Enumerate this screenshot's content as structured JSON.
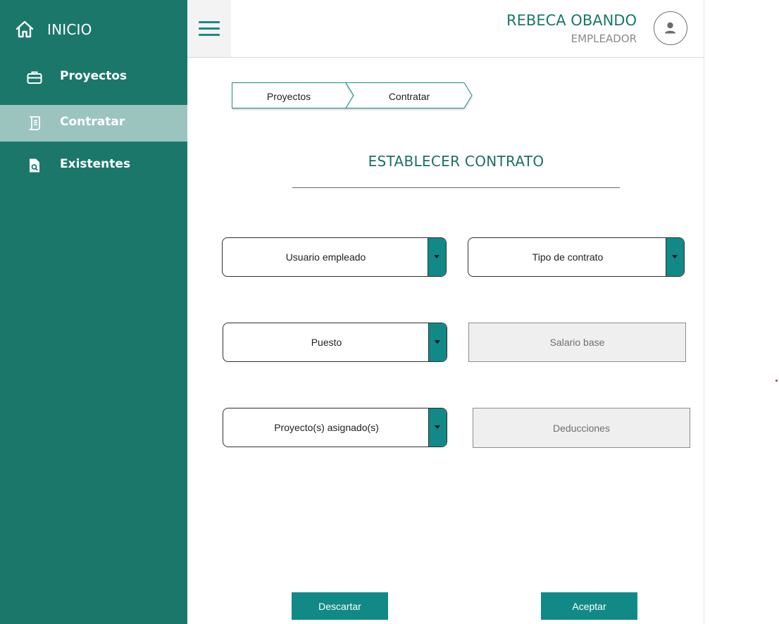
{
  "sidebar": {
    "home": {
      "label": "INICIO",
      "icon": "home-icon"
    },
    "items": [
      {
        "label": "Proyectos",
        "icon": "briefcase-icon",
        "active": false
      },
      {
        "label": "Contratar",
        "icon": "contract-icon",
        "active": true
      },
      {
        "label": "Existentes",
        "icon": "document-search-icon",
        "active": false
      }
    ]
  },
  "header": {
    "menu_icon": "hamburger-menu-icon",
    "user_name": "REBECA OBANDO",
    "user_role": "EMPLEADOR",
    "avatar_icon": "user-avatar-icon"
  },
  "breadcrumb": [
    "Proyectos",
    "Contratar"
  ],
  "form": {
    "title": "ESTABLECER CONTRATO",
    "selects": {
      "usuario_empleado": "Usuario empleado",
      "tipo_contrato": "Tipo de contrato",
      "puesto": "Puesto",
      "proyectos_asignados": "Proyecto(s) asignado(s)"
    },
    "readonly": {
      "salario_base": "Salario base",
      "deducciones": "Deducciones"
    }
  },
  "actions": {
    "discard": "Descartar",
    "accept": "Aceptar"
  },
  "colors": {
    "sidebar": "#1c776b",
    "sidebar_active": "#9bc4bf",
    "accent": "#118a87",
    "title": "#1c6f66"
  }
}
